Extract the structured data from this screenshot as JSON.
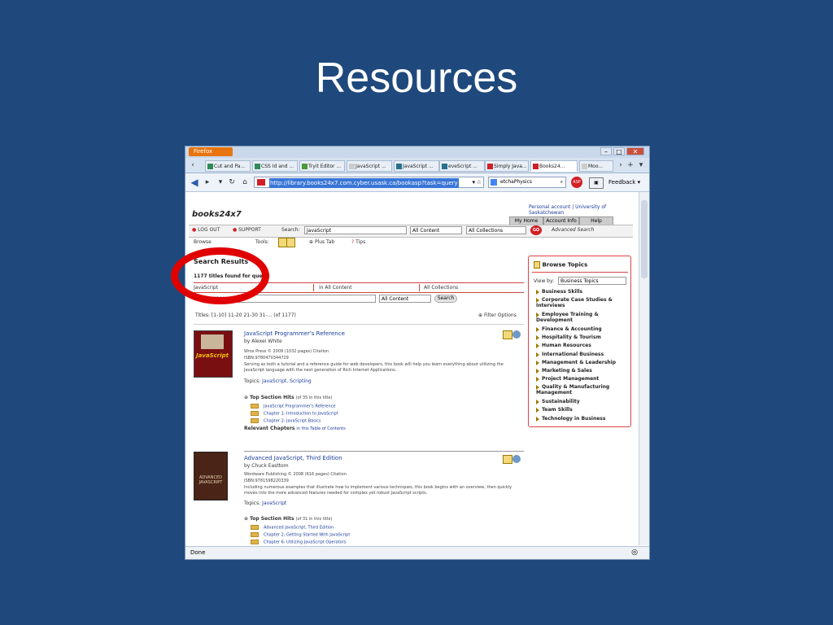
{
  "slide": {
    "title": "Resources"
  },
  "browser": {
    "app_button": "Firefox",
    "window_controls": [
      "–",
      "□",
      "✕"
    ],
    "tabs": [
      "Cut and Pa...",
      "CSS Id and ...",
      "Tryit Editor ...",
      "JavaScript ...",
      "JavaScript ...",
      "eveScript ...",
      "Simply Java...",
      "Books24...",
      "Moo..."
    ],
    "url": "http://library.books24x7.com.cyber.usask.ca/bookasp?task=query",
    "search_text": "etchaPhysics",
    "feedback": "Feedback",
    "status": "Done"
  },
  "site": {
    "logo": "books24x7",
    "account_links": "Personal account | University of Saskatchewan",
    "top_tabs": [
      "My Home",
      "Account Info",
      "Help"
    ],
    "logout": "LOG OUT",
    "support": "SUPPORT",
    "search_label": "Search:",
    "search_value": "JavaScript",
    "scope1": "All Content",
    "scope2": "All Collections",
    "go": "GO",
    "advanced": "Advanced Search",
    "browse": "Browse",
    "tools": "Tools:",
    "plus_tab": "Plus Tab",
    "tips": "Tips"
  },
  "results": {
    "heading": "Search Results",
    "count_line": "1177 titles found for query:",
    "query_terms": [
      "JavaScript",
      "in All Content",
      "All Collections"
    ],
    "search_within": "Search Within",
    "within_scope": "All Content",
    "search_btn": "Search",
    "pager": "Titles: [1-10]   11-20   21-30   31-...   (of 1177)",
    "filter": "Filter Options",
    "books": [
      {
        "title": "JavaScript Programmer's Reference",
        "author": "by Alexei White",
        "publisher": "Wrox Press © 2009 (1032 pages) Citation",
        "isbn": "ISBN:9780470344729",
        "desc": "Serving as both a tutorial and a reference guide for web developers, this book will help you learn everything about utilizing the JavaScript language with the next generation of Rich Internet Applications.",
        "topics_label": "Topics:",
        "topics": "JavaScript, Scripting",
        "hits_label": "Top Section Hits",
        "hits_note": "(of 35 in this title)",
        "hits": [
          "JavaScript Programmer's Reference",
          "Chapter 1: Introduction to JavaScript",
          "Chapter 2: JavaScript Basics"
        ],
        "relevant": "Relevant Chapters",
        "relevant_note": "in this Table of Contents",
        "cover_text": "JavaScript"
      },
      {
        "title": "Advanced JavaScript, Third Edition",
        "author": "by Chuck Easttom",
        "publisher": "Wordware Publishing © 2008 (616 pages) Citation",
        "isbn": "ISBN:9781598220339",
        "desc": "Including numerous examples that illustrate how to implement various techniques, this book begins with an overview, then quickly moves into the more advanced features needed for complex yet robust JavaScript scripts.",
        "topics_label": "Topics:",
        "topics": "JavaScript",
        "hits_label": "Top Section Hits",
        "hits_note": "(of 31 in this title)",
        "hits": [
          "Advanced JavaScript, Third Edition",
          "Chapter 2: Getting Started With JavaScript",
          "Chapter 6: Utilizing JavaScript Operators"
        ],
        "cover_text": "ADVANCED JAVASCRIPT"
      }
    ]
  },
  "browse_topics": {
    "title": "Browse Topics",
    "view_by_label": "View by:",
    "view_by_value": "Business Topics",
    "items": [
      "Business Skills",
      "Corporate Case Studies & Interviews",
      "Employee Training & Development",
      "Finance & Accounting",
      "Hospitality & Tourism",
      "Human Resources",
      "International Business",
      "Management & Leadership",
      "Marketing & Sales",
      "Project Management",
      "Quality & Manufacturing Management",
      "Sustainability",
      "Team Skills",
      "Technology in Business"
    ]
  },
  "colors": {
    "slide_bg": "#1f497d",
    "annotation": "#e00000",
    "brand_red": "#d11f26"
  }
}
